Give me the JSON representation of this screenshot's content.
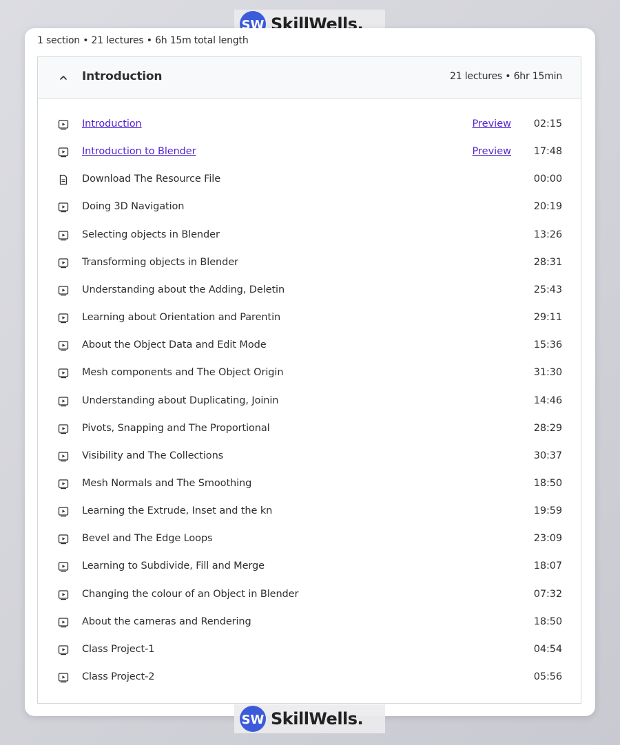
{
  "watermark": {
    "text": "SkillWells.",
    "logo_text": "SW",
    "color": "#3b5bdb"
  },
  "summary": "1 section • 21 lectures • 6h 15m total length",
  "section": {
    "title": "Introduction",
    "meta": "21 lectures • 6hr 15min",
    "expanded": true
  },
  "lectures": [
    {
      "type": "video",
      "title": "Introduction",
      "preview": "Preview",
      "duration": "02:15"
    },
    {
      "type": "video",
      "title": "Introduction to Blender",
      "preview": "Preview",
      "duration": "17:48"
    },
    {
      "type": "file",
      "title": "Download The Resource File",
      "duration": "00:00"
    },
    {
      "type": "video",
      "title": "Doing 3D Navigation",
      "duration": "20:19"
    },
    {
      "type": "video",
      "title": "Selecting objects in Blender",
      "duration": "13:26"
    },
    {
      "type": "video",
      "title": "Transforming objects in Blender",
      "duration": "28:31"
    },
    {
      "type": "video",
      "title": "Understanding about the Adding, Deletin",
      "duration": "25:43"
    },
    {
      "type": "video",
      "title": "Learning about Orientation and Parentin",
      "duration": "29:11"
    },
    {
      "type": "video",
      "title": "About the Object Data and Edit Mode",
      "duration": "15:36"
    },
    {
      "type": "video",
      "title": "Mesh components and The Object Origin",
      "duration": "31:30"
    },
    {
      "type": "video",
      "title": "Understanding about Duplicating, Joinin",
      "duration": "14:46"
    },
    {
      "type": "video",
      "title": "Pivots, Snapping and The Proportional",
      "duration": "28:29"
    },
    {
      "type": "video",
      "title": "Visibility and The Collections",
      "duration": "30:37"
    },
    {
      "type": "video",
      "title": "Mesh Normals and The Smoothing",
      "duration": "18:50"
    },
    {
      "type": "video",
      "title": "Learning the Extrude, Inset and the kn",
      "duration": "19:59"
    },
    {
      "type": "video",
      "title": "Bevel and The Edge Loops",
      "duration": "23:09"
    },
    {
      "type": "video",
      "title": "Learning to Subdivide, Fill and Merge",
      "duration": "18:07"
    },
    {
      "type": "video",
      "title": "Changing the colour of an Object in Blender",
      "duration": "07:32"
    },
    {
      "type": "video",
      "title": "About the cameras and Rendering",
      "duration": "18:50"
    },
    {
      "type": "video",
      "title": "Class Project-1",
      "duration": "04:54"
    },
    {
      "type": "video",
      "title": "Class Project-2",
      "duration": "05:56"
    }
  ]
}
